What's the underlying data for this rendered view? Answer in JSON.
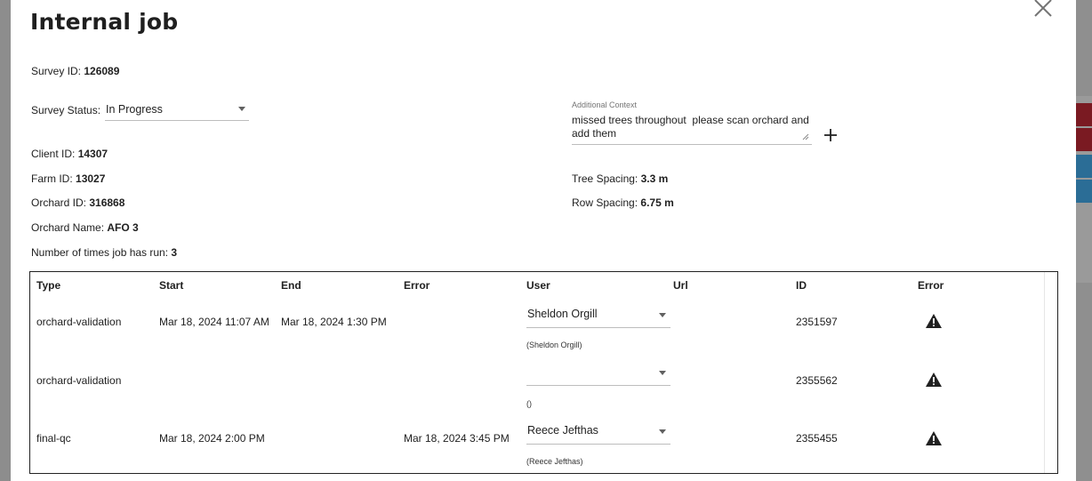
{
  "modal": {
    "title": "Internal job",
    "close_icon": "close-icon"
  },
  "survey": {
    "id_label": "Survey ID:",
    "id_value": "126089",
    "status_label": "Survey Status:",
    "status_value": "In Progress",
    "client_label": "Client ID:",
    "client_value": "14307",
    "farm_label": "Farm ID:",
    "farm_value": "13027",
    "orchard_id_label": "Orchard ID:",
    "orchard_id_value": "316868",
    "orchard_name_label": "Orchard Name:",
    "orchard_name_value": "AFO 3",
    "runs_label": "Number of times job has run:",
    "runs_value": "3"
  },
  "context": {
    "label": "Additional Context",
    "value": "missed trees throughout  please scan orchard and add them",
    "add_icon": "plus-icon"
  },
  "spacing": {
    "tree_label": "Tree Spacing:",
    "tree_value": "3.3 m",
    "row_label": "Row Spacing:",
    "row_value": "6.75 m"
  },
  "table": {
    "headers": {
      "type": "Type",
      "start": "Start",
      "end": "End",
      "error": "Error",
      "user": "User",
      "url": "Url",
      "id": "ID",
      "error2": "Error"
    },
    "rows": [
      {
        "type": "orchard-validation",
        "start": "Mar 18, 2024 11:07 AM",
        "end": "Mar 18, 2024 1:30 PM",
        "error": "",
        "user": "Sheldon Orgill",
        "user_sub": "(Sheldon Orgill)",
        "url": "",
        "id": "2351597",
        "error_icon": "warning-icon"
      },
      {
        "type": "orchard-validation",
        "start": "",
        "end": "",
        "error": "",
        "user": "",
        "user_sub": "()",
        "url": "",
        "id": "2355562",
        "error_icon": "warning-icon"
      },
      {
        "type": "final-qc",
        "start": "Mar 18, 2024 2:00 PM",
        "end": "",
        "error": "Mar 18, 2024 3:45 PM",
        "user": "Reece Jefthas",
        "user_sub": "(Reece Jefthas)",
        "url": "",
        "id": "2355455",
        "error_icon": "warning-icon"
      }
    ]
  }
}
